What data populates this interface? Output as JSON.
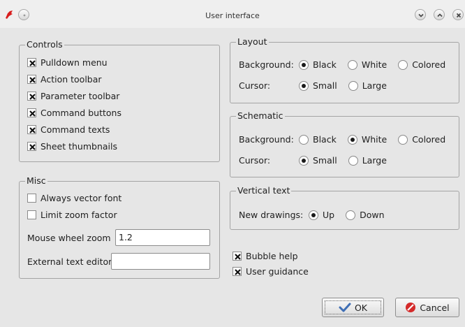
{
  "window": {
    "title": "User interface"
  },
  "controls": {
    "legend": "Controls",
    "items": [
      {
        "label": "Pulldown menu",
        "checked": true
      },
      {
        "label": "Action toolbar",
        "checked": true
      },
      {
        "label": "Parameter toolbar",
        "checked": true
      },
      {
        "label": "Command buttons",
        "checked": true
      },
      {
        "label": "Command texts",
        "checked": true
      },
      {
        "label": "Sheet thumbnails",
        "checked": true
      }
    ]
  },
  "misc": {
    "legend": "Misc",
    "always_vector_font": {
      "label": "Always vector font",
      "checked": false
    },
    "limit_zoom_factor": {
      "label": "Limit zoom factor",
      "checked": false
    },
    "mouse_wheel_zoom": {
      "label": "Mouse wheel zoom",
      "value": "1.2"
    },
    "external_text_editor": {
      "label": "External text editor",
      "value": ""
    }
  },
  "layout": {
    "legend": "Layout",
    "background": {
      "label": "Background:",
      "options": [
        "Black",
        "White",
        "Colored"
      ],
      "selected": "Black"
    },
    "cursor": {
      "label": "Cursor:",
      "options": [
        "Small",
        "Large"
      ],
      "selected": "Small"
    }
  },
  "schematic": {
    "legend": "Schematic",
    "background": {
      "label": "Background:",
      "options": [
        "Black",
        "White",
        "Colored"
      ],
      "selected": "White"
    },
    "cursor": {
      "label": "Cursor:",
      "options": [
        "Small",
        "Large"
      ],
      "selected": "Small"
    }
  },
  "vertical_text": {
    "legend": "Vertical text",
    "new_drawings": {
      "label": "New drawings:",
      "options": [
        "Up",
        "Down"
      ],
      "selected": "Up"
    }
  },
  "bubble_help": {
    "label": "Bubble help",
    "checked": true
  },
  "user_guidance": {
    "label": "User guidance",
    "checked": true
  },
  "buttons": {
    "ok": "OK",
    "cancel": "Cancel"
  }
}
